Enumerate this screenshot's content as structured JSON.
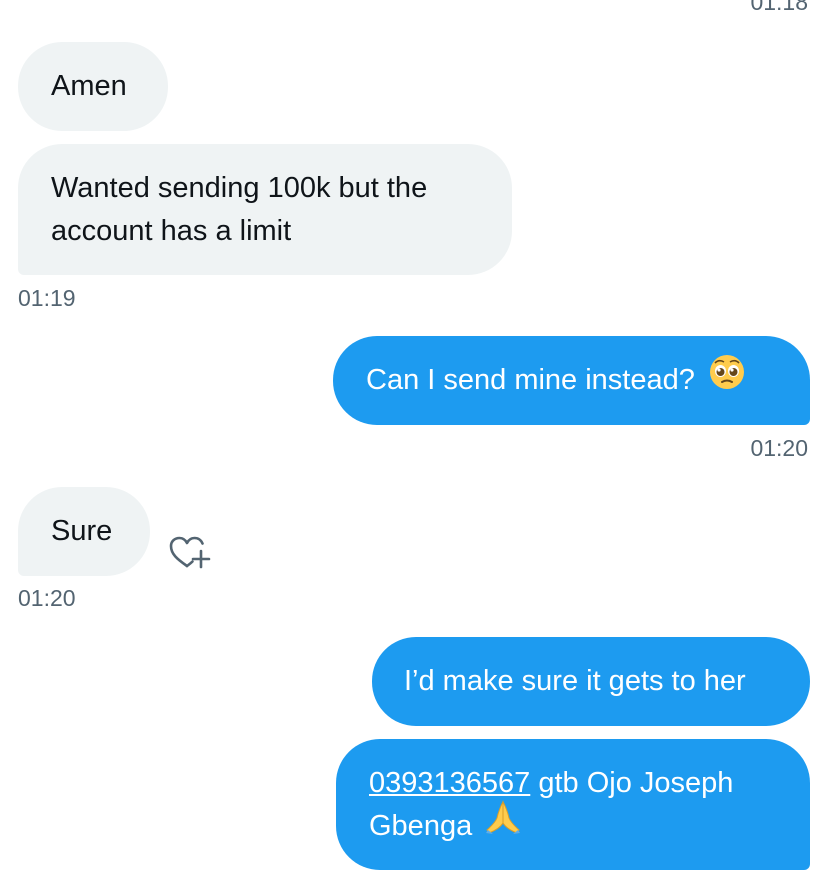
{
  "messages": {
    "top_time": "01:18",
    "m1": "Amen",
    "m2_line1": "Wanted sending 100k but the",
    "m2_line2": "account has a limit",
    "t2": "01:19",
    "m3": "Can I send mine instead?",
    "t3": "01:20",
    "m4": "Sure",
    "t4": "01:20",
    "m5": "I’d make sure it gets to her",
    "m6_link": "0393136567",
    "m6_rest": " gtb Ojo Joseph",
    "m6_line2": "Gbenga"
  },
  "colors": {
    "incoming_bubble": "#eff3f4",
    "outgoing_bubble": "#1d9bf0",
    "timestamp": "#536471"
  },
  "icons": {
    "react": "heart-plus-icon",
    "emoji1": "pleading-face-emoji",
    "emoji2": "folded-hands-emoji"
  }
}
